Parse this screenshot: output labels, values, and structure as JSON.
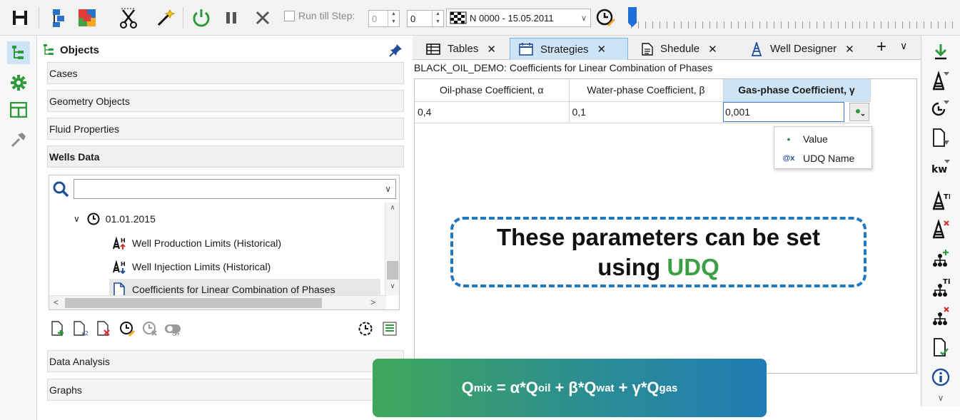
{
  "toolbar": {
    "run_till_step_label": "Run till Step:",
    "run_till_step_value": "0",
    "step_value": "0",
    "step_selector": "N 0000 - 15.05.2011"
  },
  "objects_panel": {
    "title": "Objects",
    "sections_top": [
      "Cases",
      "Geometry Objects",
      "Fluid Properties",
      "Wells Data"
    ],
    "sections_bottom": [
      "Data Analysis",
      "Graphs"
    ],
    "search": {
      "value": ""
    },
    "tree": [
      {
        "label": "01.01.2015",
        "icon": "clock-icon"
      },
      {
        "label": "Well Production Limits (Historical)",
        "icon": "well-limits-production-icon"
      },
      {
        "label": "Well Injection Limits (Historical)",
        "icon": "well-limits-injection-icon"
      },
      {
        "label": "Coefficients for Linear Combination of Phases",
        "icon": "document-icon",
        "selected": true
      }
    ]
  },
  "tabs": [
    {
      "label": "Tables",
      "icon": "table-icon",
      "active": false
    },
    {
      "label": "Strategies",
      "icon": "calendar-icon",
      "active": true
    },
    {
      "label": "Shedule",
      "icon": "schedule-icon",
      "active": false
    },
    {
      "label": "Well Designer",
      "icon": "well-icon",
      "active": false
    }
  ],
  "content": {
    "title": "BLACK_OIL_DEMO: Coefficients for Linear Combination of Phases",
    "columns": [
      "Oil-phase Coefficient, α",
      "Water-phase Coefficient, β",
      "Gas-phase Coefficient, γ"
    ],
    "row": [
      "0,4",
      "0,1",
      "0,001"
    ],
    "popup": [
      {
        "marker": "•",
        "label": "Value"
      },
      {
        "marker": "@x",
        "label": "UDQ Name"
      }
    ]
  },
  "callout": {
    "line1": "These parameters can be set",
    "line2_prefix": "using ",
    "line2_highlight": "UDQ"
  },
  "formula": {
    "q": "Q",
    "mix": "mix",
    "eq": " = α*Q",
    "oil": "oil",
    "plus1": " + β*Q",
    "wat": "wat",
    "plus2": " + γ*Q",
    "gas": "gas"
  },
  "colors": {
    "accent_blue": "#1f78c0",
    "accent_green": "#3aa043",
    "tab_active": "#cde4f7"
  }
}
